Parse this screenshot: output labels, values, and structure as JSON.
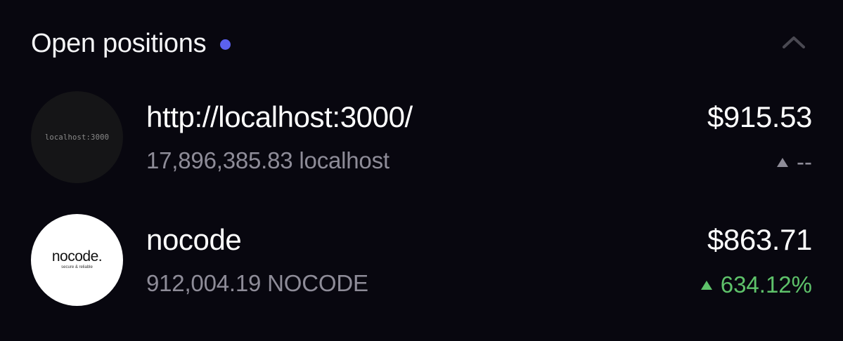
{
  "header": {
    "title": "Open positions",
    "dot_color": "#5b61f0",
    "collapse_icon": "chevron-up-icon"
  },
  "positions": [
    {
      "logo_text": "localhost:3000",
      "name": "http://localhost:3000/",
      "amount": "17,896,385.83 localhost",
      "value": "$915.53",
      "change": "--",
      "change_direction": "neutral"
    },
    {
      "logo_word": "nocode.",
      "logo_tagline": "secure & reliable",
      "name": "nocode",
      "amount": "912,004.19 NOCODE",
      "value": "$863.71",
      "change": "634.12%",
      "change_direction": "up"
    }
  ],
  "colors": {
    "background": "#08070f",
    "accent_dot": "#5b61f0",
    "positive": "#5ec26a",
    "muted": "#8e8c98"
  }
}
